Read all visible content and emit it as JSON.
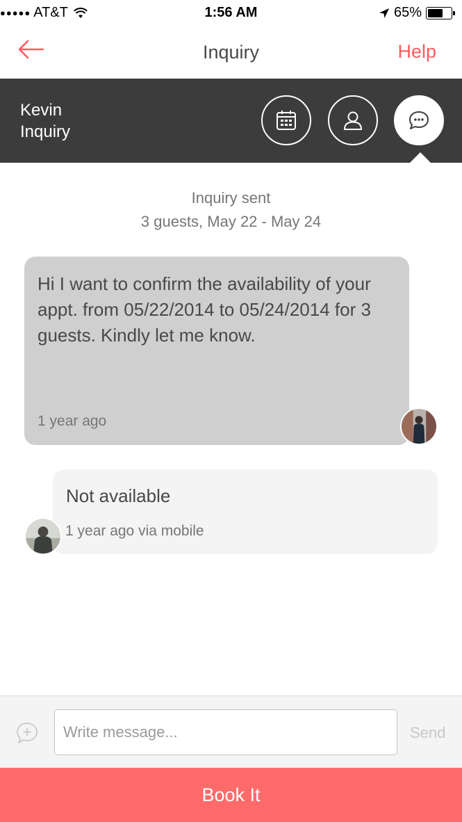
{
  "status_bar": {
    "signal": "●●●●●",
    "carrier": "AT&T",
    "time": "1:56 AM",
    "battery_percent": "65%",
    "battery_level": 0.65,
    "icons": [
      "wifi-icon",
      "location-arrow-icon",
      "battery-icon"
    ]
  },
  "nav": {
    "title": "Inquiry",
    "help_label": "Help",
    "back_icon": "back-arrow-icon",
    "accent_color": "#ff5a5f"
  },
  "thread_header": {
    "name": "Kevin",
    "status": "Inquiry",
    "background": "#3c3c3c",
    "tabs": [
      {
        "icon": "calendar-icon",
        "active": false
      },
      {
        "icon": "user-icon",
        "active": false
      },
      {
        "icon": "chat-bubble-icon",
        "active": true
      }
    ]
  },
  "conversation": {
    "meta_title": "Inquiry sent",
    "meta_detail": "3 guests, May 22 - May 24",
    "messages": [
      {
        "text": "Hi I want to confirm the availability of your appt. from 05/22/2014 to 05/24/2014 for 3 guests. Kindly let me know.",
        "time": "1 year ago",
        "direction": "incoming"
      },
      {
        "text": "Not available",
        "time": "1 year ago via mobile",
        "direction": "outgoing"
      }
    ]
  },
  "composer": {
    "placeholder": "Write message...",
    "value": "",
    "send_label": "Send",
    "attach_icon": "add-comment-icon"
  },
  "book_button": {
    "label": "Book It",
    "color": "#ff6b6b"
  }
}
